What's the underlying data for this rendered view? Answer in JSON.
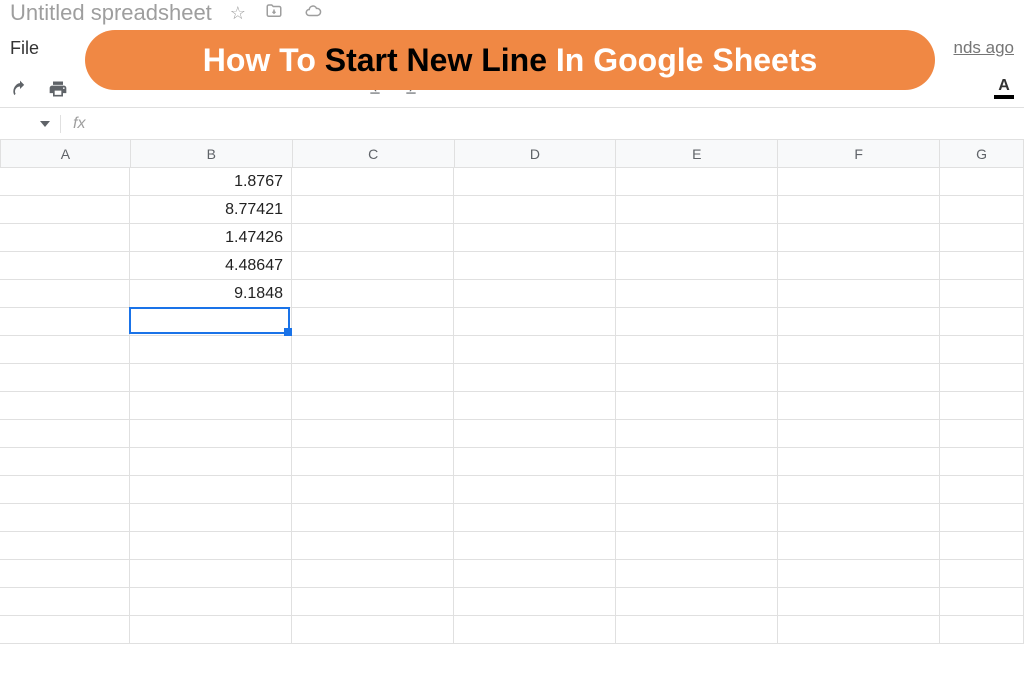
{
  "title": "Untitled spreadsheet",
  "menu": {
    "file": "File"
  },
  "lastEdit": "nds ago",
  "overlay": {
    "part1": "How To ",
    "part2": "Start New Line ",
    "part3": "In Google Sheets"
  },
  "toolbar": {
    "textColorLetter": "A"
  },
  "formulaBar": {
    "fxLabel": "fx",
    "value": ""
  },
  "columns": [
    "A",
    "B",
    "C",
    "D",
    "E",
    "F",
    "G"
  ],
  "cells": {
    "B1": "1.8767",
    "B2": "8.77421",
    "B3": "1.47426",
    "B4": "4.48647",
    "B5": "9.1848"
  },
  "activeCell": "B6",
  "rowCount": 17
}
